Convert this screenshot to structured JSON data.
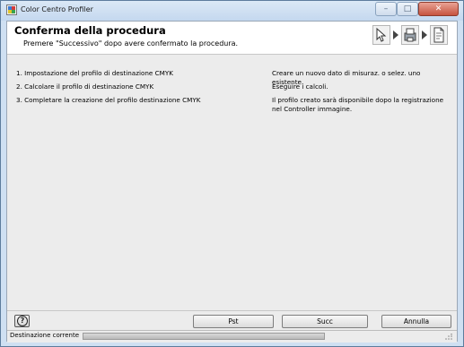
{
  "window": {
    "title": "Color Centro Profiler",
    "app_icon": "app-icon",
    "controls": {
      "minimize": "–",
      "maximize": "□",
      "close": "✕"
    }
  },
  "header": {
    "title": "Conferma della procedura",
    "subtitle": "Premere \"Successivo\" dopo avere confermato la procedura.",
    "step_icons": [
      "arrow-cursor-icon",
      "printer-icon",
      "profile-document-icon"
    ]
  },
  "procedure": [
    {
      "step": "1. Impostazione del profilo di destinazione CMYK",
      "note": "Creare un nuovo dato di misuraz. o selez. uno esistente."
    },
    {
      "step": "2. Calcolare il profilo di destinazione CMYK",
      "note": "Eseguire i calcoli."
    },
    {
      "step": "3. Completare la creazione del profilo destinazione CMYK",
      "note": "Il profilo creato sarà disponibile dopo la registrazione nel Controller immagine."
    }
  ],
  "footer": {
    "help_label": "?",
    "prev_label": "Pst",
    "next_label": "Succ",
    "cancel_label": "Annulla"
  },
  "status": {
    "label": "Destinazione corrente",
    "progress": 0
  }
}
